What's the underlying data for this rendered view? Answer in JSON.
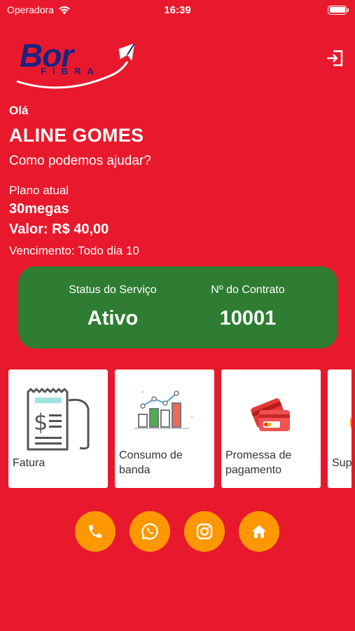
{
  "status_bar": {
    "carrier": "Operadora",
    "time": "16:39"
  },
  "logo": {
    "text": "Bor",
    "sub": "FIBRA"
  },
  "greeting": {
    "hello": "Olá",
    "name": "ALINE GOMES",
    "prompt": "Como podemos ajudar?"
  },
  "plan": {
    "label": "Plano atual",
    "name": "30megas",
    "price": "Valor: R$ 40,00",
    "due": "Vencimento: Todo dia 10"
  },
  "service": {
    "status_label": "Status do Serviço",
    "status_value": "Ativo",
    "contract_label": "Nº do Contrato",
    "contract_value": "10001"
  },
  "menu": [
    {
      "line1": "Fatura",
      "line2": "",
      "icon": "invoice-icon"
    },
    {
      "line1": "Consumo de",
      "line2": "banda",
      "icon": "bandwidth-chart-icon"
    },
    {
      "line1": "Promessa de",
      "line2": "pagamento",
      "icon": "credit-card-icon"
    },
    {
      "line1": "Sup",
      "line2": "",
      "icon": "support-icon"
    }
  ],
  "actions": [
    {
      "icon": "phone-icon"
    },
    {
      "icon": "whatsapp-icon"
    },
    {
      "icon": "instagram-icon"
    },
    {
      "icon": "home-icon"
    }
  ],
  "colors": {
    "background": "#e8192c",
    "status_card": "#2e7d32",
    "action_button": "#ff9800",
    "logo_blue": "#1a237e"
  }
}
